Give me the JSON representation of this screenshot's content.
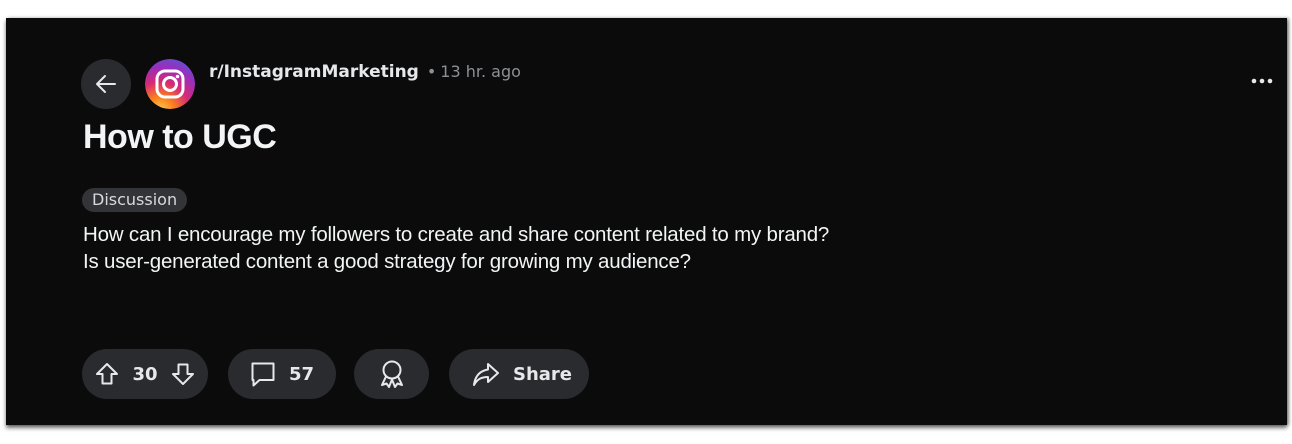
{
  "post": {
    "subreddit": "r/InstagramMarketing",
    "separator": "•",
    "time_ago": "13 hr. ago",
    "title": "How to UGC",
    "flair": "Discussion",
    "body_lines": [
      "How can I encourage my followers to create and share content related to my brand?",
      "Is user-generated content a good strategy for growing my audience?"
    ]
  },
  "actions": {
    "votes": "30",
    "comments": "57",
    "share_label": "Share"
  },
  "icons": {
    "back": "arrow-left-icon",
    "avatar": "instagram-logo-icon",
    "more": "more-horizontal-icon",
    "upvote": "arrow-up-icon",
    "downvote": "arrow-down-icon",
    "comment": "comment-bubble-icon",
    "award": "award-icon",
    "share": "share-arrow-icon"
  },
  "colors": {
    "background": "#0b0b0b",
    "pill": "#2a2b2e",
    "text": "#f2f4f5",
    "muted": "#8c9196",
    "flair_bg": "#333437"
  }
}
